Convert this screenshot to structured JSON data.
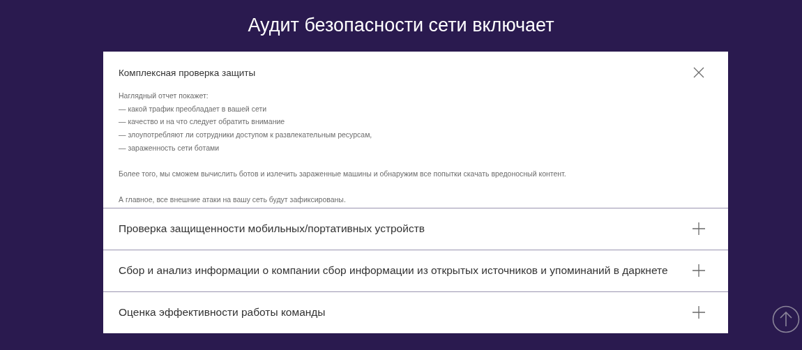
{
  "heading": "Аудит безопасности сети включает",
  "accordion": [
    {
      "title": "Комплексная проверка защиты",
      "expanded": true,
      "body": [
        [
          "Наглядный отчет покажет:",
          "— какой трафик преобладает в вашей сети",
          "— качество и на что следует обратить внимание",
          "— злоупотребляют ли сотрудники доступом к развлекательным ресурсам,",
          "— зараженность сети ботами"
        ],
        [
          "Более того, мы сможем вычислить ботов и излечить зараженные машины и обнаружим все попытки скачать вредоносный контент."
        ],
        [
          "А главное, все внешние атаки на вашу сеть будут зафиксированы."
        ]
      ]
    },
    {
      "title": "Проверка защищенности мобильных/портативных устройств",
      "expanded": false
    },
    {
      "title": "Сбор и анализ информации о компании сбор информации из открытых источников и упоминаний в даркнете",
      "expanded": false
    },
    {
      "title": "Оценка эффективности работы команды",
      "expanded": false
    }
  ]
}
